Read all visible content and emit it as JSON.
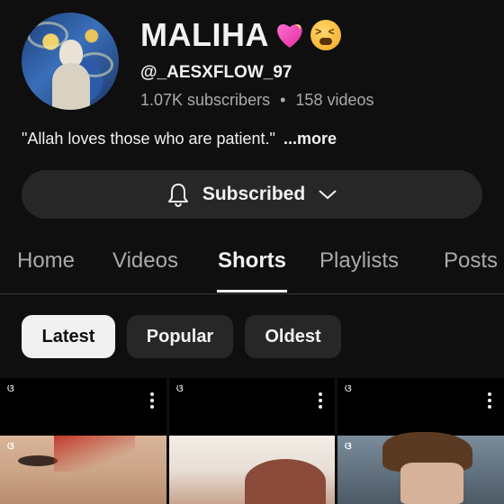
{
  "channel": {
    "name": "MALIHA",
    "name_emojis": [
      "sparkling-heart",
      "tired-face"
    ],
    "handle": "@_AESXFLOW_97",
    "subscribers": "1.07K subscribers",
    "separator": "•",
    "videos": "158 videos",
    "bio": "\"Allah loves those who are patient.\"",
    "bio_more": "...more"
  },
  "subscribe_button": {
    "label": "Subscribed",
    "icon": "bell-icon",
    "dropdown_icon": "chevron-down-icon"
  },
  "tabs": [
    {
      "label": "Home",
      "active": false
    },
    {
      "label": "Videos",
      "active": false
    },
    {
      "label": "Shorts",
      "active": true
    },
    {
      "label": "Playlists",
      "active": false
    },
    {
      "label": "Posts",
      "active": false
    }
  ],
  "filters": [
    {
      "label": "Latest",
      "active": true
    },
    {
      "label": "Popular",
      "active": false
    },
    {
      "label": "Oldest",
      "active": false
    }
  ],
  "shorts": [
    {
      "badge_icon": "capcut-icon",
      "menu_icon": "more-vert-icon"
    },
    {
      "badge_icon": "capcut-icon",
      "menu_icon": "more-vert-icon"
    },
    {
      "badge_icon": "capcut-icon",
      "menu_icon": "more-vert-icon"
    }
  ],
  "colors": {
    "background": "#0f0f0f",
    "surface": "#272727",
    "text_primary": "#f1f1f1",
    "text_secondary": "#aaaaaa"
  }
}
